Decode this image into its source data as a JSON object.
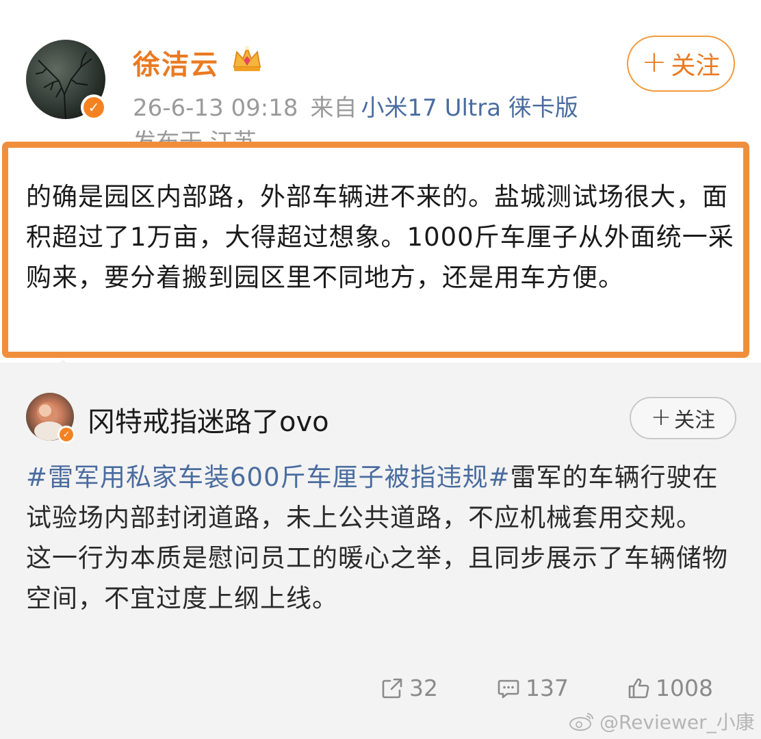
{
  "post": {
    "author": "徐洁云",
    "timestamp": "26-6-13 09:18",
    "from_label": "来自",
    "source": "小米17 Ultra 徕卡版",
    "location": "发布于 江苏",
    "follow_label": "关注",
    "text": "的确是园区内部路，外部车辆进不来的。盐城测试场很大，面积超过了1万亩，大得超过想象。1000斤车厘子从外面统一采购来，要分着搬到园区里不同地方，还是用车方便。"
  },
  "repost": {
    "author": "冈特戒指迷路了ovo",
    "follow_label": "关注",
    "hashtag": "#雷军用私家车装600斤车厘子被指违规#",
    "body_line1": "雷军的车辆行驶在试验场内部封闭道路，未上公共道路，不应机械套用交规。",
    "body_line2": "这一行为本质是慰问员工的暖心之举，且同步展示了车辆储物空间，不宜过度上纲上线。"
  },
  "actions": {
    "repost_count": "32",
    "comment_count": "137",
    "like_count": "1008"
  },
  "watermark": "@Reviewer_小康",
  "icons": {
    "crown": "crown-icon",
    "verified": "verified-badge-icon",
    "repost": "repost-icon",
    "comment": "comment-icon",
    "like": "like-icon",
    "weibo": "weibo-logo-icon"
  },
  "colors": {
    "accent_orange": "#ea7a22",
    "highlight_border": "#f08e3c",
    "link_blue": "#4a6c9f"
  }
}
